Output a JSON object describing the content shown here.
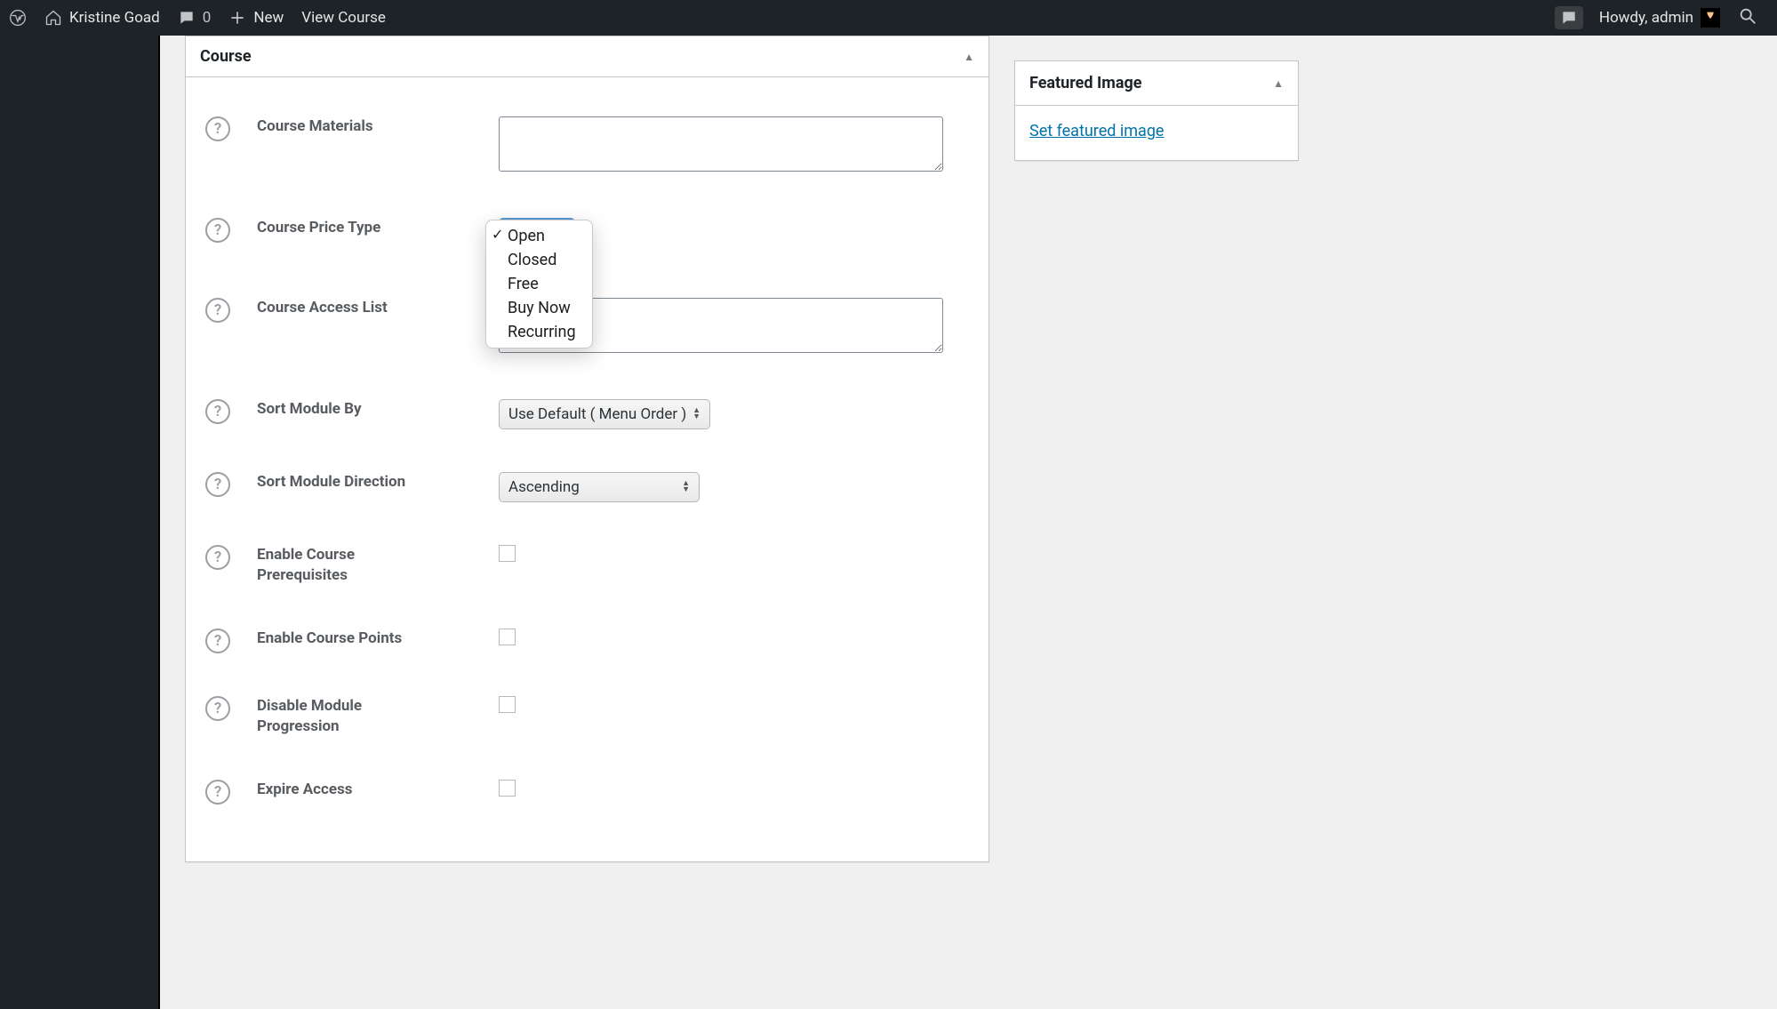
{
  "adminbar": {
    "site_name": "Kristine Goad",
    "comments_count": "0",
    "new_label": "New",
    "view_course_label": "View Course",
    "howdy": "Howdy, admin"
  },
  "metabox": {
    "title": "Course",
    "fields": {
      "course_materials": {
        "label": "Course Materials",
        "value": ""
      },
      "price_type": {
        "label": "Course Price Type",
        "selected": "Open",
        "options": [
          "Open",
          "Closed",
          "Free",
          "Buy Now",
          "Recurring"
        ]
      },
      "access_list": {
        "label": "Course Access List",
        "value": ""
      },
      "sort_module_by": {
        "label": "Sort Module By",
        "selected": "Use Default ( Menu Order )"
      },
      "sort_module_direction": {
        "label": "Sort Module Direction",
        "selected": "Ascending"
      },
      "enable_prereq": {
        "label": "Enable Course Prerequisites",
        "checked": false
      },
      "enable_points": {
        "label": "Enable Course Points",
        "checked": false
      },
      "disable_progression": {
        "label": "Disable Module Progression",
        "checked": false
      },
      "expire_access": {
        "label": "Expire Access",
        "checked": false
      }
    }
  },
  "sidebox": {
    "title": "Featured Image",
    "link_label": "Set featured image"
  }
}
